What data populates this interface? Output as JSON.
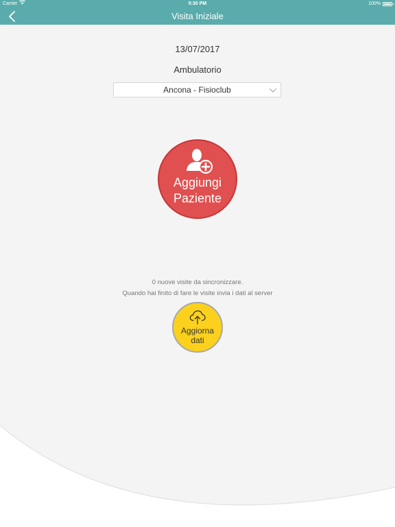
{
  "status_bar": {
    "carrier": "Carrier",
    "wifi_icon": "wifi-icon",
    "time": "5:30 PM",
    "battery": "100%",
    "battery_icon": "battery-icon",
    "battery_level": 1.0
  },
  "nav": {
    "title": "Visita Iniziale",
    "back_icon": "chevron-left-icon"
  },
  "main": {
    "date": "13/07/2017",
    "ambulatorio_label": "Ambulatorio",
    "ambulatorio_selected": "Ancona - Fisioclub",
    "dropdown_icon": "chevron-down-icon",
    "add_patient": {
      "icon": "add-user-icon",
      "line1": "Aggiungi",
      "line2": "Paziente"
    },
    "sync_info_line1": "0 nuove visite da sincronizzare.",
    "sync_info_line2": "Quando hai finito di fare le visite invia i dati al server",
    "update_data": {
      "icon": "cloud-upload-icon",
      "line1": "Aggiorna",
      "line2": "dati"
    }
  },
  "colors": {
    "header": "#5aacac",
    "background": "#f4f4f4",
    "add_button": "#e05050",
    "add_button_border": "#c93535",
    "update_button": "#fbd11e",
    "update_button_border": "#a8a8a8"
  }
}
